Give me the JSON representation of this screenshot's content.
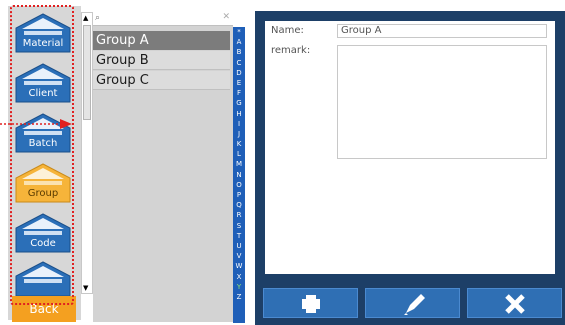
{
  "nav": {
    "items": [
      {
        "label": "Material",
        "icon": "material-icon"
      },
      {
        "label": "Client",
        "icon": "client-icon"
      },
      {
        "label": "Batch",
        "icon": "batch-icon"
      },
      {
        "label": "Group",
        "icon": "group-icon"
      },
      {
        "label": "Code",
        "icon": "code-icon"
      },
      {
        "label": "",
        "icon": "more-icon"
      }
    ],
    "active_item": "Group",
    "back_label": "Back"
  },
  "list": {
    "search_placeholder": "",
    "items": [
      "Group A",
      "Group B",
      "Group C"
    ],
    "selected": "Group A"
  },
  "alphabet": [
    "*",
    "A",
    "B",
    "C",
    "D",
    "E",
    "F",
    "G",
    "H",
    "I",
    "J",
    "K",
    "L",
    "M",
    "N",
    "O",
    "P",
    "Q",
    "R",
    "S",
    "T",
    "U",
    "V",
    "W",
    "X",
    "Y",
    "Z"
  ],
  "detail": {
    "name_label": "Name:",
    "name_value": "Group A",
    "remark_label": "remark:",
    "remark_value": ""
  },
  "actions": {
    "add_icon": "plus-icon",
    "edit_icon": "pencil-icon",
    "delete_icon": "x-icon"
  },
  "colors": {
    "nav_button": "#2b6fb8",
    "nav_button_active": "#f6b43a",
    "back_button": "#f4a020",
    "detail_panel": "#1d3f67",
    "alphabet_bar": "#1f5fb8",
    "highlight_dotted": "#e02020"
  }
}
